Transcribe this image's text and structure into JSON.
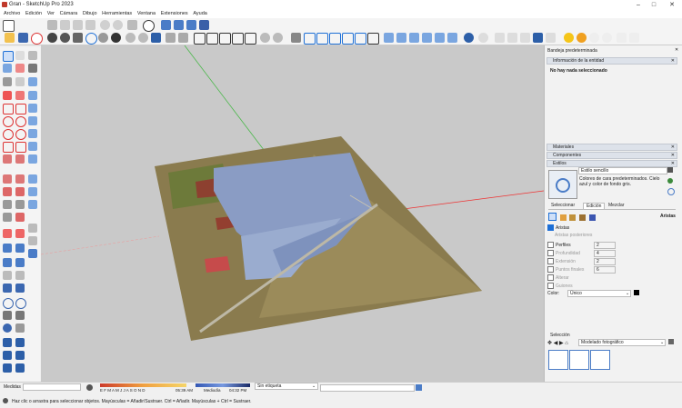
{
  "window": {
    "title": "Gran - SketchUp Pro 2023",
    "minimize": "–",
    "maximize": "□",
    "close": "✕"
  },
  "menu": [
    "Archivo",
    "Edición",
    "Ver",
    "Cámara",
    "Dibujo",
    "Herramientas",
    "Ventana",
    "Extensiones",
    "Ayuda"
  ],
  "panel": {
    "title": "Bandeja predeterminada",
    "entity_header": "Información de la entidad",
    "entity_text": "No hay nada seleccionado",
    "materials": "Materiales",
    "components": "Componentes",
    "styles": "Estilos",
    "style_name": "Estilo sencillo",
    "style_desc": "Colores de cara predeterminados. Cielo azul y color de fondo gris.",
    "tabs": [
      "Seleccionar",
      "Edición",
      "Mezclar"
    ],
    "edges_label": "Aristas",
    "edges_checkbox": "Aristas",
    "profile_edges": "Aristas posteriores",
    "profiles": "Perfiles",
    "profiles_val": "2",
    "depth": "Profundidad",
    "depth_val": "4",
    "extension": "Extensión",
    "extension_val": "2",
    "endpoints": "Puntos finales",
    "endpoints_val": "6",
    "jitter": "Alterar",
    "dashes": "Guiones",
    "color_label": "Color:",
    "color_value": "Único",
    "selection_label": "Selección",
    "model_select": "Modelado fotográfico"
  },
  "status": {
    "measures": "Medidas",
    "months": "E F M A M J J A S O N D",
    "time1": "05:39 AM",
    "noon": "Mediodía",
    "time2": "04:32 PM",
    "tag": "Sin etiqueta",
    "hint": "Haz clic o arrastra para seleccionar objetos. Mayúsculas = Añadir/Sustraer. Ctrl = Añadir. Mayúsculas + Ctrl = Sustraer."
  },
  "colors": {
    "accent": "#1d6fd6",
    "sky": "#c9c9c9",
    "terrain": "#8a7b4e",
    "panels": "#8a9cc4"
  }
}
